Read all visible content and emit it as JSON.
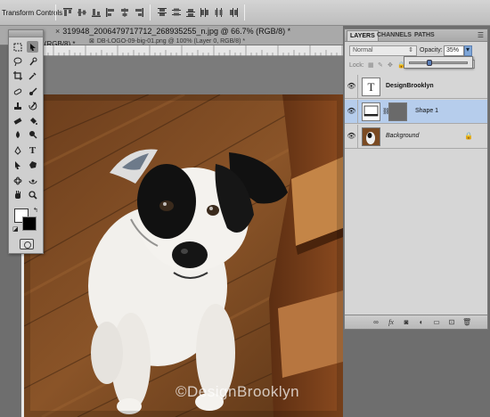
{
  "options_bar": {
    "label": "Transform Controls"
  },
  "document": {
    "active_tab": "319948_2006479717712_268935255_n.jpg @ 66.7% (RGB/8) *",
    "active_tab_partial": "7% (RGB/8) *",
    "second_tab": "DB-LOGO-09-big-01.png @ 100% (Layer 0, RGB/8) *",
    "watermark": "©DesignBrooklyn"
  },
  "layers_panel": {
    "tabs": [
      "LAYERS",
      "CHANNELS",
      "PATHS"
    ],
    "blend_mode": "Normal",
    "opacity_label": "Opacity:",
    "opacity_value": "35%",
    "opacity_slider_level": 0.35,
    "lock_label": "Lock:",
    "layers": [
      {
        "name": "DesignBrooklyn",
        "kind": "text",
        "thumb_glyph": "T"
      },
      {
        "name": "Shape 1",
        "kind": "shape"
      },
      {
        "name": "Background",
        "kind": "image",
        "locked": true
      }
    ],
    "footer_icons": [
      "link-layers-icon",
      "fx-icon",
      "add-mask-icon",
      "adjustment-layer-icon",
      "new-group-icon",
      "new-layer-icon",
      "delete-layer-icon"
    ]
  },
  "colors": {
    "selection_blue": "#b6cdec",
    "foreground": "#ffffff",
    "background": "#000000"
  }
}
